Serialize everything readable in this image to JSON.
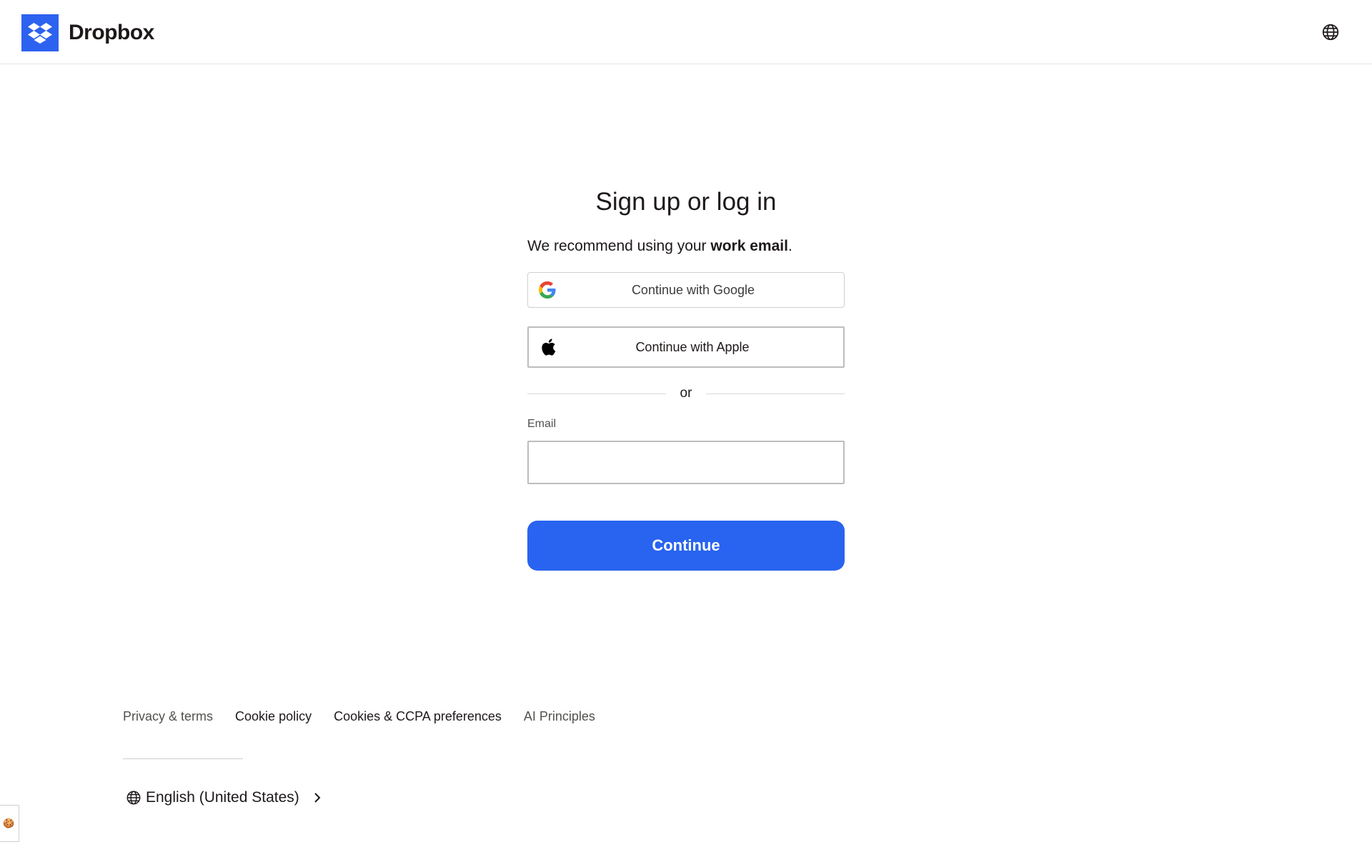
{
  "header": {
    "brand_name": "Dropbox",
    "brand_color": "#2d62f0",
    "language_icon": "globe-icon"
  },
  "main": {
    "title": "Sign up or log in",
    "subtitle_prefix": "We recommend using your ",
    "subtitle_emphasis": "work email",
    "subtitle_suffix": ".",
    "google_button_label": "Continue with Google",
    "google_icon": "google-icon",
    "apple_button_label": "Continue with Apple",
    "apple_icon": "apple-icon",
    "divider_text": "or",
    "email_label": "Email",
    "email_value": "",
    "continue_button_label": "Continue",
    "continue_button_color": "#2864f0"
  },
  "footer": {
    "links": [
      "Privacy & terms",
      "Cookie policy",
      "Cookies & CCPA preferences",
      "AI Principles"
    ],
    "language_label": "English (United States)",
    "language_icon": "globe-icon",
    "chevron_icon": "chevron-right-icon"
  },
  "cookie_widget": {
    "icon": "cookie-icon",
    "glyph": "🍪"
  }
}
